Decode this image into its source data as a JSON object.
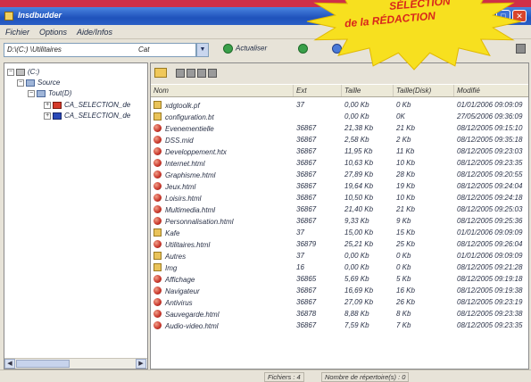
{
  "colors": {
    "page_strip": "#cf2f48",
    "titlebar": "#1f52bb",
    "window": "#e7e3d8",
    "badge_fill": "#f7e01f",
    "badge_text": "#d9261c"
  },
  "badge": {
    "line1": "SÉLECTION",
    "line2": "de la RÉDACTION"
  },
  "window": {
    "title": "Insdbudder",
    "icon": "app-icon",
    "minimize": "_",
    "maximize": "□",
    "close": "✕"
  },
  "menu": [
    {
      "label": "Fichier"
    },
    {
      "label": "Options"
    },
    {
      "label": "Aide/Infos"
    }
  ],
  "toolbar": {
    "address": "D:\\(C:) \\Utilitaires",
    "address_suffix": "Cat",
    "refresh_label": "Actualiser",
    "icons": [
      "refresh-icon",
      "back-icon",
      "home-icon",
      "settings-icon"
    ]
  },
  "tree": [
    {
      "label": "(C:)",
      "expander": "−",
      "icon": "drive-icon"
    },
    {
      "label": "Source",
      "expander": "−",
      "icon": "folder-icon"
    },
    {
      "label": "Tout(D)",
      "expander": "−",
      "icon": "folder-icon"
    },
    {
      "label": "CA_SELECTION_de",
      "expander": "+",
      "icon": "red-file-icon"
    },
    {
      "label": "CA_SELECTION_de",
      "expander": "+",
      "icon": "blue-file-icon"
    }
  ],
  "list": {
    "columns": [
      "Nom",
      "Ext",
      "Taille",
      "Taille(Disk)",
      "Modifié"
    ],
    "rows": [
      {
        "icon": "folder-icon",
        "name": "xdgtoolk.pf",
        "ext": "37",
        "size": "0,00 Kb",
        "disk": "0 Kb",
        "date": "01/01/2006 09:09:09"
      },
      {
        "icon": "folder-icon",
        "name": "configuration.bt",
        "ext": "",
        "size": "0,00 Kb",
        "disk": "0K",
        "date": "27/05/2006 09:36:09"
      },
      {
        "icon": "html-file-icon",
        "name": "Evenementielle",
        "ext": "36867",
        "size": "21,38 Kb",
        "disk": "21 Kb",
        "date": "08/12/2005 09:15:10"
      },
      {
        "icon": "html-file-icon",
        "name": "DSS.mid",
        "ext": "36867",
        "size": "2,58 Kb",
        "disk": "2 Kb",
        "date": "08/12/2005 09:35:18"
      },
      {
        "icon": "html-file-icon",
        "name": "Developpement.htx",
        "ext": "36867",
        "size": "11,95 Kb",
        "disk": "11 Kb",
        "date": "08/12/2005 09:23:03"
      },
      {
        "icon": "html-file-icon",
        "name": "Internet.html",
        "ext": "36867",
        "size": "10,63 Kb",
        "disk": "10 Kb",
        "date": "08/12/2005 09:23:35"
      },
      {
        "icon": "html-file-icon",
        "name": "Graphisme.html",
        "ext": "36867",
        "size": "27,89 Kb",
        "disk": "28 Kb",
        "date": "08/12/2005 09:20:55"
      },
      {
        "icon": "html-file-icon",
        "name": "Jeux.html",
        "ext": "36867",
        "size": "19,64 Kb",
        "disk": "19 Kb",
        "date": "08/12/2005 09:24:04"
      },
      {
        "icon": "html-file-icon",
        "name": "Loisirs.html",
        "ext": "36867",
        "size": "10,50 Kb",
        "disk": "10 Kb",
        "date": "08/12/2005 09:24:18"
      },
      {
        "icon": "html-file-icon",
        "name": "Multimedia.html",
        "ext": "36867",
        "size": "21,40 Kb",
        "disk": "21 Kb",
        "date": "08/12/2005 09:25:03"
      },
      {
        "icon": "html-file-icon",
        "name": "Personnalisation.html",
        "ext": "36867",
        "size": "9,33 Kb",
        "disk": "9 Kb",
        "date": "08/12/2005 09:25:36"
      },
      {
        "icon": "folder-icon",
        "name": "Kafe",
        "ext": "37",
        "size": "15,00 Kb",
        "disk": "15 Kb",
        "date": "01/01/2006 09:09:09"
      },
      {
        "icon": "html-file-icon",
        "name": "Utilitaires.html",
        "ext": "36879",
        "size": "25,21 Kb",
        "disk": "25 Kb",
        "date": "08/12/2005 09:26:04"
      },
      {
        "icon": "folder-icon",
        "name": "Autres",
        "ext": "37",
        "size": "0,00 Kb",
        "disk": "0 Kb",
        "date": "01/01/2006 09:09:09"
      },
      {
        "icon": "folder-icon",
        "name": "Img",
        "ext": "16",
        "size": "0,00 Kb",
        "disk": "0 Kb",
        "date": "08/12/2005 09:21:28"
      },
      {
        "icon": "html-file-icon",
        "name": "Affichage",
        "ext": "36865",
        "size": "5,69 Kb",
        "disk": "5 Kb",
        "date": "08/12/2005 09:19:18"
      },
      {
        "icon": "html-file-icon",
        "name": "Navigateur",
        "ext": "36867",
        "size": "16,69 Kb",
        "disk": "16 Kb",
        "date": "08/12/2005 09:19:38"
      },
      {
        "icon": "html-file-icon",
        "name": "Antivirus",
        "ext": "36867",
        "size": "27,09 Kb",
        "disk": "26 Kb",
        "date": "08/12/2005 09:23:19"
      },
      {
        "icon": "html-file-icon",
        "name": "Sauvegarde.html",
        "ext": "36878",
        "size": "8,88 Kb",
        "disk": "8 Kb",
        "date": "08/12/2005 09:23:38"
      },
      {
        "icon": "html-file-icon",
        "name": "Audio-video.html",
        "ext": "36867",
        "size": "7,59 Kb",
        "disk": "7 Kb",
        "date": "08/12/2005 09:23:35"
      }
    ]
  },
  "status": {
    "files": "Fichiers : 4",
    "folders": "Nombre de répertoire(s) : 0"
  }
}
